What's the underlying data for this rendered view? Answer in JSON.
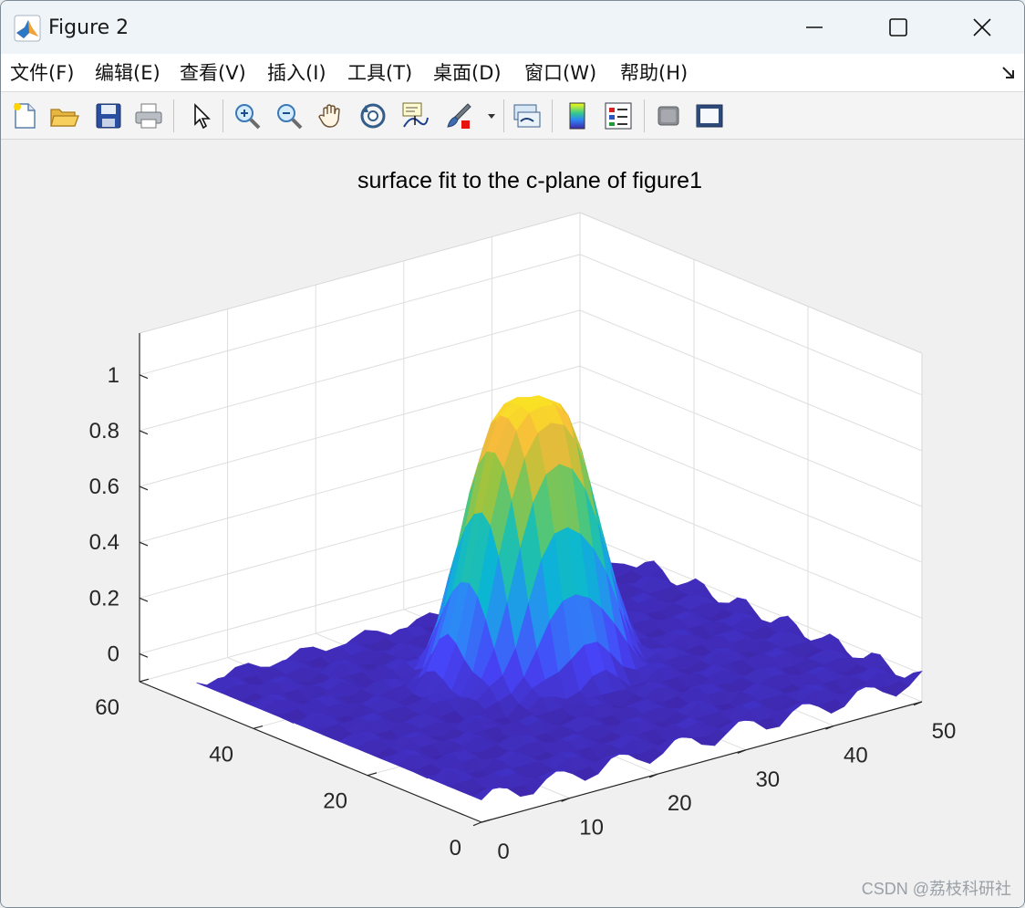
{
  "window": {
    "title": "Figure 2"
  },
  "menu": [
    {
      "label": "文件(F)",
      "name": "menu-file"
    },
    {
      "label": "编辑(E)",
      "name": "menu-edit"
    },
    {
      "label": "查看(V)",
      "name": "menu-view"
    },
    {
      "label": "插入(I)",
      "name": "menu-insert"
    },
    {
      "label": "工具(T)",
      "name": "menu-tools"
    },
    {
      "label": "桌面(D)",
      "name": "menu-desktop"
    },
    {
      "label": "窗口(W)",
      "name": "menu-window"
    },
    {
      "label": "帮助(H)",
      "name": "menu-help"
    }
  ],
  "toolbar": [
    {
      "icon": "new-figure-icon"
    },
    {
      "icon": "open-file-icon"
    },
    {
      "icon": "save-icon"
    },
    {
      "icon": "print-icon"
    },
    {
      "icon": "pointer-icon"
    },
    {
      "icon": "zoom-in-icon"
    },
    {
      "icon": "zoom-out-icon"
    },
    {
      "icon": "pan-hand-icon"
    },
    {
      "icon": "rotate-3d-icon"
    },
    {
      "icon": "data-cursor-icon"
    },
    {
      "icon": "brush-icon"
    },
    {
      "icon": "link-plot-icon"
    },
    {
      "icon": "colorbar-icon"
    },
    {
      "icon": "legend-icon"
    },
    {
      "icon": "hide-plot-tools-icon"
    },
    {
      "icon": "show-plot-tools-icon"
    }
  ],
  "colors": {
    "colormap": [
      "#3e26a8",
      "#4743f8",
      "#2e87f7",
      "#0ab6d3",
      "#33c78f",
      "#a7c339",
      "#f8ba3d",
      "#f9fb15"
    ]
  },
  "chart_data": {
    "type": "surface",
    "title": "surface fit to the c-plane of figure1",
    "x_ticks": [
      0,
      10,
      20,
      30,
      40,
      50
    ],
    "y_ticks": [
      0,
      20,
      40,
      60
    ],
    "z_ticks": [
      0,
      0.2,
      0.4,
      0.6,
      0.8,
      1
    ],
    "z_tick_labels": [
      "0",
      "0.2",
      "0.4",
      "0.6",
      "0.8",
      "1"
    ],
    "xlim": [
      0,
      50
    ],
    "ylim": [
      0,
      60
    ],
    "zlim": [
      -0.1,
      1.15
    ],
    "grid": true,
    "colormap": "parula",
    "view": "3d",
    "peak_z": 1.0,
    "peak_center": [
      25,
      30
    ],
    "surface_extent": {
      "x": [
        0,
        50
      ],
      "y": [
        0,
        50
      ]
    }
  },
  "watermark": "CSDN @荔枝科研社"
}
